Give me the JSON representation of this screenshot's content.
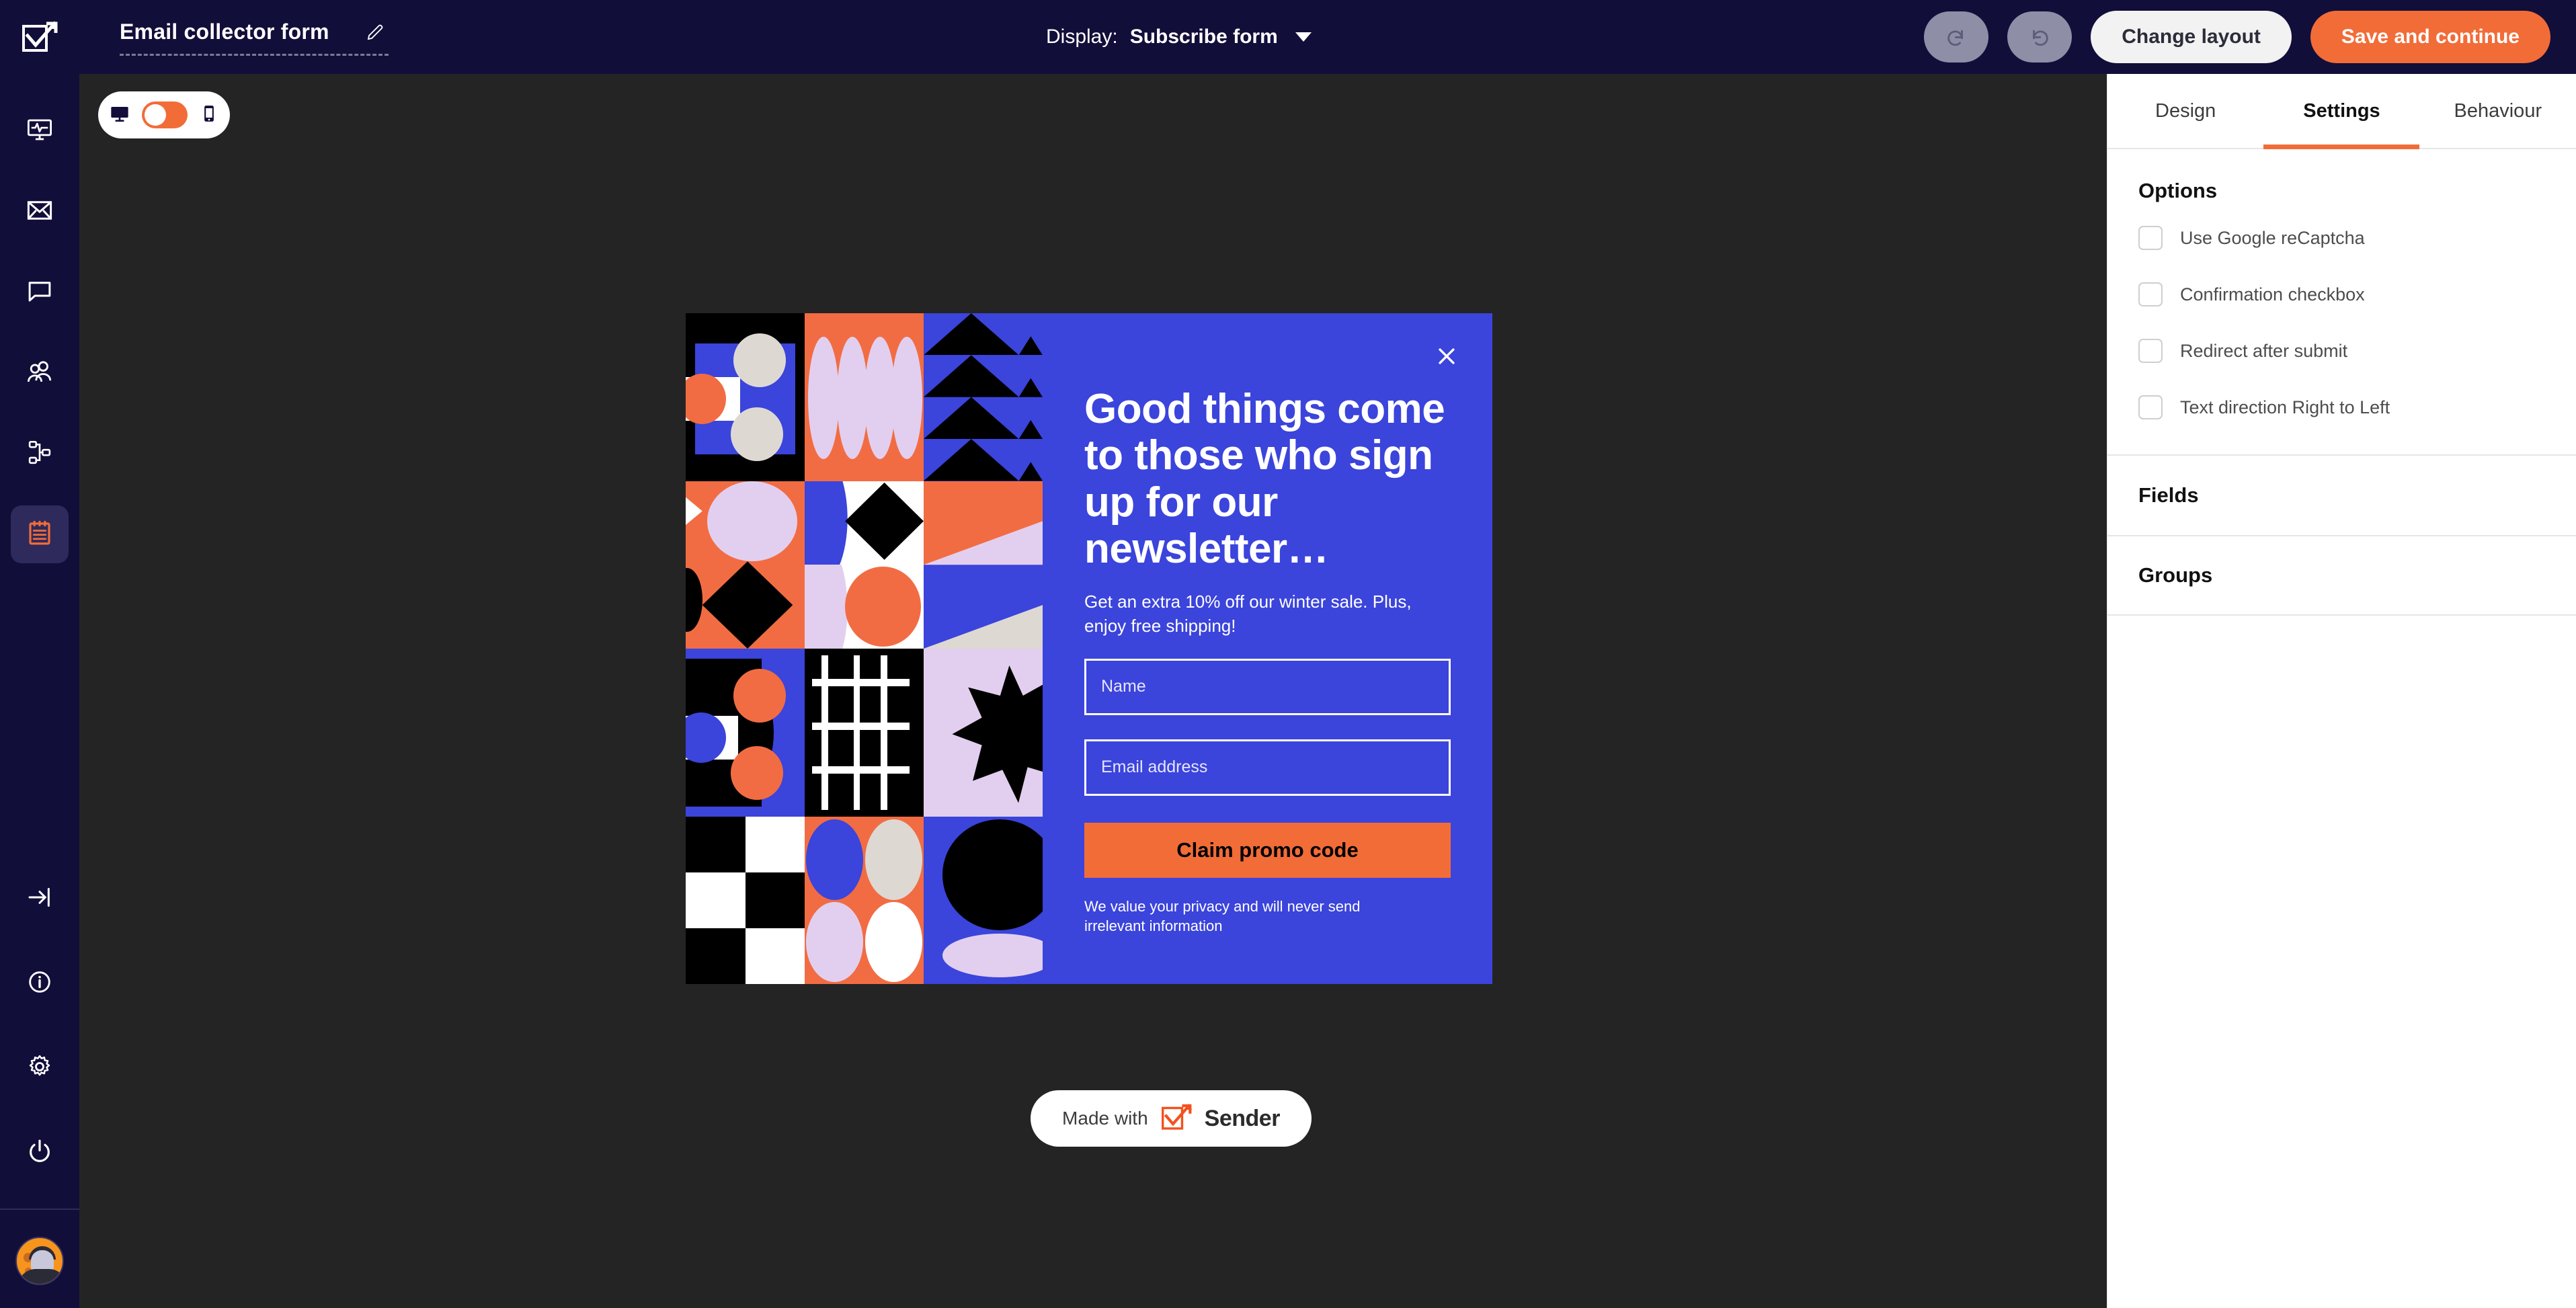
{
  "topbar": {
    "logo_icon": "sender-checkmark-arrow-logo",
    "doc_title": "Email collector form",
    "edit_icon": "pencil-icon",
    "display_label": "Display:",
    "display_value": "Subscribe form",
    "display_caret_icon": "chevron-down-icon",
    "undo_icon": "undo-icon",
    "redo_icon": "redo-icon",
    "change_layout_label": "Change layout",
    "save_label": "Save and continue",
    "colors": {
      "bar_bg": "#120e3a",
      "accent": "#f26c38"
    }
  },
  "rail": {
    "items": [
      {
        "icon": "monitor-pulse-icon",
        "name": "dashboard",
        "active": false
      },
      {
        "icon": "envelope-icon",
        "name": "campaigns",
        "active": false
      },
      {
        "icon": "chat-bubble-icon",
        "name": "messages",
        "active": false
      },
      {
        "icon": "people-group-icon",
        "name": "subscribers",
        "active": false
      },
      {
        "icon": "automation-flow-icon",
        "name": "automation",
        "active": false
      },
      {
        "icon": "form-clipboard-icon",
        "name": "forms",
        "active": true
      }
    ],
    "bottom_items": [
      {
        "icon": "collapse-arrow-icon",
        "name": "collapse-sidebar"
      },
      {
        "icon": "info-circle-icon",
        "name": "help"
      },
      {
        "icon": "gear-icon",
        "name": "settings"
      },
      {
        "icon": "power-icon",
        "name": "logout"
      }
    ],
    "avatar": "user-avatar"
  },
  "canvas": {
    "bg_color": "#242424",
    "device_toggle": {
      "desktop_icon": "desktop-monitor-icon",
      "mobile_icon": "mobile-phone-icon",
      "state": "desktop"
    },
    "made_with": {
      "label": "Made with",
      "brand": "Sender",
      "icon": "sender-logo-icon"
    }
  },
  "popup": {
    "bg_color": "#3b44db",
    "close_icon": "close-x-icon",
    "headline": "Good things come to those who sign up for our newsletter…",
    "subtext": "Get an extra 10% off our winter sale. Plus, enjoy free shipping!",
    "fields": [
      {
        "name": "name-field",
        "placeholder": "Name",
        "value": ""
      },
      {
        "name": "email-field",
        "placeholder": "Email address",
        "value": ""
      }
    ],
    "cta_label": "Claim promo code",
    "privacy_text": "We value your privacy and will never send irrelevant information",
    "pattern_colors": {
      "blue": "#3b44db",
      "orange": "#f26c43",
      "lilac": "#e2cfef",
      "cream": "#ded8d3",
      "black": "#000000",
      "white": "#ffffff"
    }
  },
  "panel": {
    "tabs": [
      {
        "label": "Design",
        "active": false
      },
      {
        "label": "Settings",
        "active": true
      },
      {
        "label": "Behaviour",
        "active": false
      }
    ],
    "options_title": "Options",
    "options": [
      {
        "label": "Use Google reCaptcha",
        "checked": false
      },
      {
        "label": "Confirmation checkbox",
        "checked": false
      },
      {
        "label": "Redirect after submit",
        "checked": false
      },
      {
        "label": "Text direction Right to Left",
        "checked": false
      }
    ],
    "fields_title": "Fields",
    "groups_title": "Groups",
    "accent": "#f26c38"
  }
}
